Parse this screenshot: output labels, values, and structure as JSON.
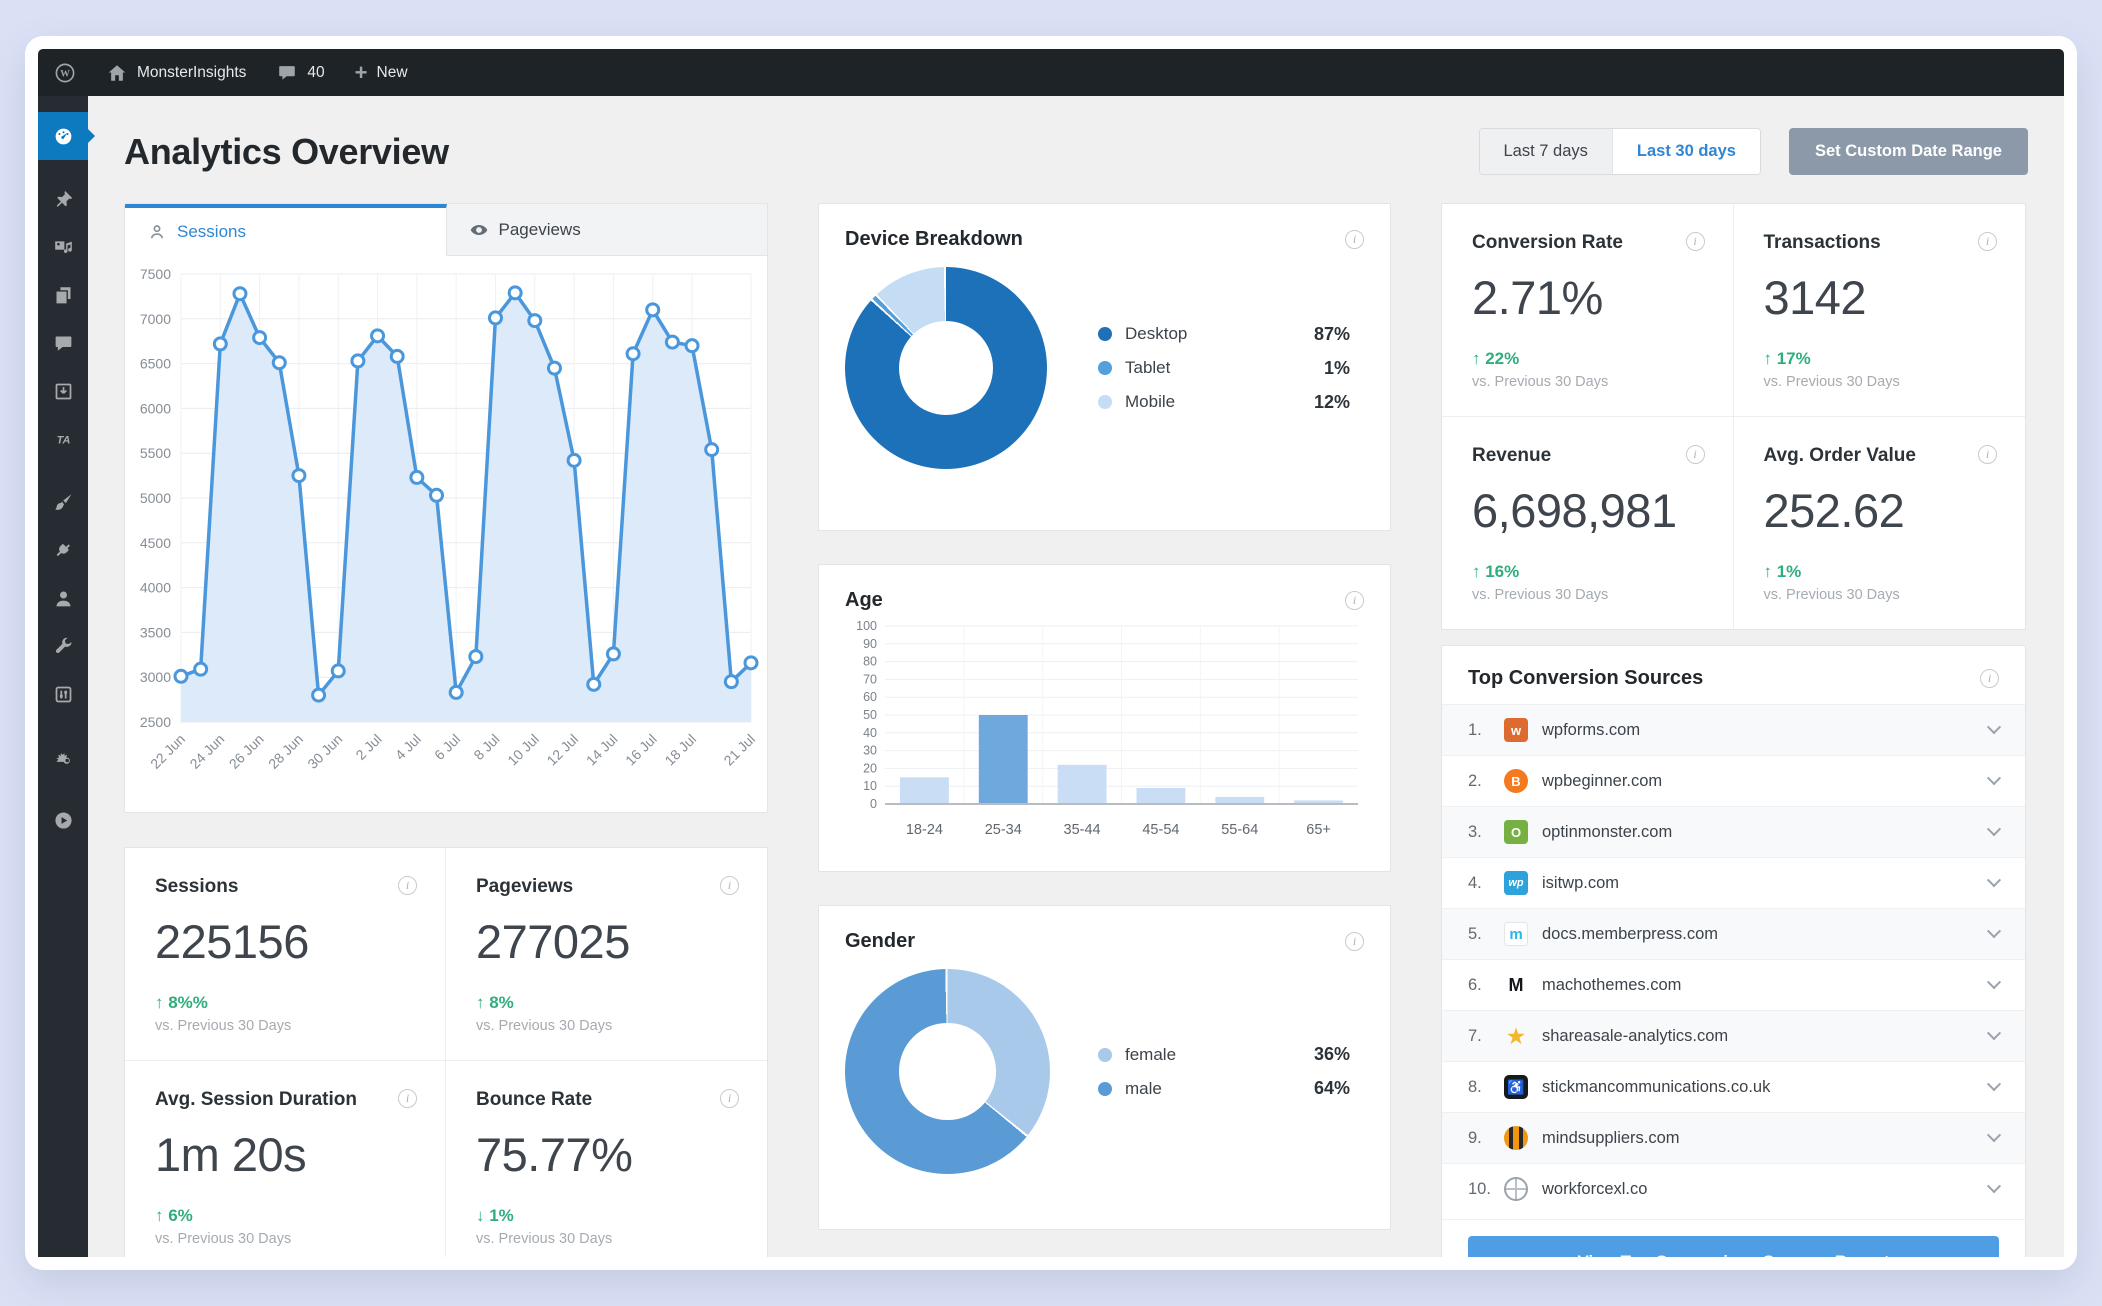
{
  "colors": {
    "accent_blue": "#2f86d2",
    "active_menu_blue": "#0d79bf",
    "positive_green": "#2fae7d",
    "admin_bar_bg": "#1e2327",
    "sidebar_bg": "#272c33",
    "content_bg": "#f0f0f1"
  },
  "admin_bar": {
    "site_label": "MonsterInsights",
    "comment_count": "40",
    "new_label": "New"
  },
  "sidebar": {
    "items": [
      {
        "name": "dashboard",
        "active": true
      },
      {
        "name": "posts-pin",
        "active": false
      },
      {
        "name": "media",
        "active": false
      },
      {
        "name": "pages",
        "active": false
      },
      {
        "name": "comments",
        "active": false
      },
      {
        "name": "downloads",
        "active": false
      },
      {
        "name": "ta-plugin",
        "active": false
      },
      {
        "name": "appearance-brush",
        "active": false
      },
      {
        "name": "plugins-plug",
        "active": false
      },
      {
        "name": "users",
        "active": false
      },
      {
        "name": "tools-wrench",
        "active": false
      },
      {
        "name": "settings-sliders",
        "active": false
      },
      {
        "name": "creature-plugin",
        "active": false
      },
      {
        "name": "video-play",
        "active": false
      }
    ]
  },
  "header": {
    "title": "Analytics Overview",
    "range_7": "Last 7 days",
    "range_30": "Last 30 days",
    "custom_range": "Set Custom Date Range"
  },
  "tabs": {
    "sessions": "Sessions",
    "pageviews": "Pageviews"
  },
  "vs_label": "vs. Previous 30 Days",
  "chart_data": [
    {
      "id": "sessions_trend",
      "type": "line",
      "title": "Sessions",
      "x_labels": [
        "22 Jun",
        "24 Jun",
        "26 Jun",
        "28 Jun",
        "30 Jun",
        "2 Jul",
        "4 Jul",
        "6 Jul",
        "8 Jul",
        "10 Jul",
        "12 Jul",
        "14 Jul",
        "16 Jul",
        "18 Jul",
        "21 Jul"
      ],
      "x_tick_positions": [
        0,
        2,
        4,
        6,
        8,
        10,
        12,
        14,
        16,
        18,
        20,
        22,
        24,
        26,
        29
      ],
      "values": [
        3010,
        3090,
        6720,
        7280,
        6790,
        6510,
        5250,
        2800,
        3070,
        6530,
        6810,
        6580,
        5230,
        5030,
        2830,
        3230,
        7010,
        7290,
        6980,
        6450,
        5420,
        2920,
        3260,
        6610,
        7100,
        6740,
        6700,
        5540,
        2950,
        3160
      ],
      "ylim": [
        2500,
        7500
      ],
      "ytick_step": 500,
      "grid": true,
      "line_color": "#4a97dc",
      "fill_color": "#dceafa"
    },
    {
      "id": "device_breakdown",
      "type": "pie",
      "title": "Device Breakdown",
      "labels": [
        "Desktop",
        "Tablet",
        "Mobile"
      ],
      "values": [
        87,
        1,
        12
      ],
      "colors": [
        "#1d71b8",
        "#54a0dc",
        "#c5ddf4"
      ],
      "legend_position": "right"
    },
    {
      "id": "age",
      "type": "bar",
      "title": "Age",
      "categories": [
        "18-24",
        "25-34",
        "35-44",
        "45-54",
        "55-64",
        "65+"
      ],
      "values": [
        15,
        50,
        22,
        9,
        4,
        2
      ],
      "ylim": [
        0,
        100
      ],
      "ytick_step": 10,
      "grid": true,
      "bar_color": "#c9def5",
      "bar_highlight": "#6fa8dc",
      "highlight_index": 1
    },
    {
      "id": "gender",
      "type": "pie",
      "title": "Gender",
      "labels": [
        "female",
        "male"
      ],
      "values": [
        36,
        64
      ],
      "colors": [
        "#a9c9ea",
        "#5b9bd5"
      ],
      "legend_position": "right"
    }
  ],
  "stats_left": [
    {
      "label": "Sessions",
      "value": "225156",
      "delta": "8%%",
      "direction": "up"
    },
    {
      "label": "Pageviews",
      "value": "277025",
      "delta": "8%",
      "direction": "up"
    },
    {
      "label": "Avg. Session Duration",
      "value": "1m 20s",
      "delta": "6%",
      "direction": "up"
    },
    {
      "label": "Bounce Rate",
      "value": "75.77%",
      "delta": "1%",
      "direction": "down"
    }
  ],
  "stats_right": [
    {
      "label": "Conversion Rate",
      "value": "2.71%",
      "delta": "22%",
      "direction": "up"
    },
    {
      "label": "Transactions",
      "value": "3142",
      "delta": "17%",
      "direction": "up"
    },
    {
      "label": "Revenue",
      "value": "6,698,981",
      "delta": "16%",
      "direction": "up"
    },
    {
      "label": "Avg. Order Value",
      "value": "252.62",
      "delta": "1%",
      "direction": "up"
    }
  ],
  "sources": {
    "title": "Top Conversion Sources",
    "button": "View Top Conversions Sources Report",
    "items": [
      {
        "rank": "1.",
        "domain": "wpforms.com",
        "icon": "bear",
        "glyph": "w"
      },
      {
        "rank": "2.",
        "domain": "wpbeginner.com",
        "icon": "person",
        "glyph": "B"
      },
      {
        "rank": "3.",
        "domain": "optinmonster.com",
        "icon": "monster",
        "glyph": "O"
      },
      {
        "rank": "4.",
        "domain": "isitwp.com",
        "icon": "wp",
        "glyph": "wp"
      },
      {
        "rank": "5.",
        "domain": "docs.memberpress.com",
        "icon": "m",
        "glyph": "m"
      },
      {
        "rank": "6.",
        "domain": "machothemes.com",
        "icon": "macho",
        "glyph": "M"
      },
      {
        "rank": "7.",
        "domain": "shareasale-analytics.com",
        "icon": "star",
        "glyph": "★"
      },
      {
        "rank": "8.",
        "domain": "stickmancommunications.co.uk",
        "icon": "wheelchair",
        "glyph": "♿"
      },
      {
        "rank": "9.",
        "domain": "mindsuppliers.com",
        "icon": "stripes",
        "glyph": ""
      },
      {
        "rank": "10.",
        "domain": "workforcexl.co",
        "icon": "globe",
        "glyph": ""
      }
    ]
  }
}
